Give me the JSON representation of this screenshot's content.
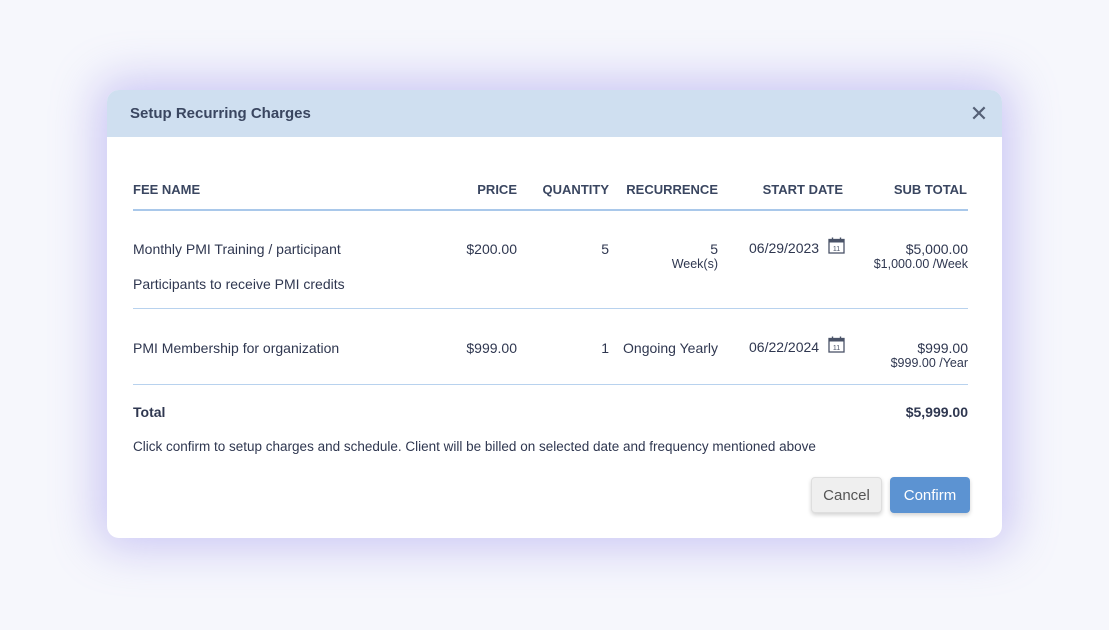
{
  "modal": {
    "title": "Setup Recurring Charges",
    "close_glyph": "✕"
  },
  "table": {
    "headers": {
      "fee_name": "FEE NAME",
      "price": "PRICE",
      "quantity": "QUANTITY",
      "recurrence": "RECURRENCE",
      "start_date": "START DATE",
      "sub_total": "SUB TOTAL"
    },
    "rows": [
      {
        "fee_name": "Monthly PMI Training / participant",
        "note": "Participants to receive PMI credits",
        "price": "$200.00",
        "quantity": "5",
        "recurrence_count": "5",
        "recurrence_unit": "Week(s)",
        "start_date": "06/29/2023",
        "sub_total": "$5,000.00",
        "rate": "$1,000.00 /Week"
      },
      {
        "fee_name": "PMI Membership for organization",
        "price": "$999.00",
        "quantity": "1",
        "recurrence": "Ongoing Yearly",
        "start_date": "06/22/2024",
        "sub_total": "$999.00",
        "rate": "$999.00 /Year"
      }
    ],
    "total_label": "Total",
    "total_value": "$5,999.00"
  },
  "message": "Click confirm to setup charges and schedule. Client will be billed on selected date and frequency mentioned above",
  "buttons": {
    "cancel": "Cancel",
    "confirm": "Confirm"
  },
  "colors": {
    "header_bg": "#cfdff0",
    "confirm_bg": "#5c93d2",
    "separator": "#a9c8ea"
  }
}
